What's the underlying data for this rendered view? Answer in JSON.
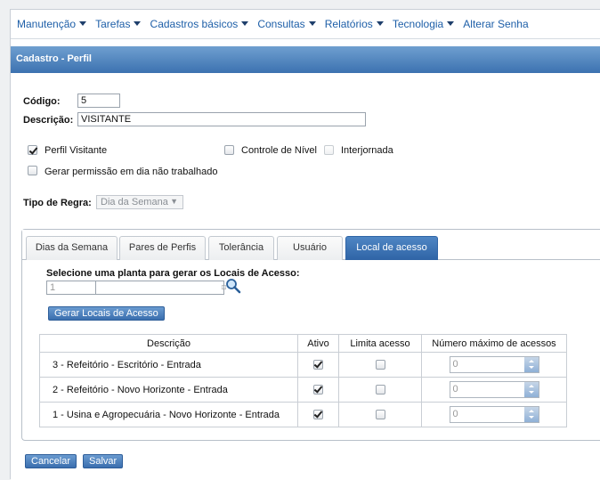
{
  "menu": {
    "items": [
      {
        "label": "Manutenção",
        "has_caret": true
      },
      {
        "label": "Tarefas",
        "has_caret": true
      },
      {
        "label": "Cadastros básicos",
        "has_caret": true
      },
      {
        "label": "Consultas",
        "has_caret": true
      },
      {
        "label": "Relatórios",
        "has_caret": true
      },
      {
        "label": "Tecnologia",
        "has_caret": true
      },
      {
        "label": "Alterar Senha",
        "has_caret": false
      }
    ]
  },
  "panel": {
    "title": "Cadastro - Perfil"
  },
  "form": {
    "codigo_label": "Código:",
    "codigo_value": "5",
    "descricao_label": "Descrição:",
    "descricao_value": "VISITANTE",
    "perfil_visitante_label": "Perfil Visitante",
    "perfil_visitante_checked": true,
    "controle_nivel_label": "Controle de Nível",
    "controle_nivel_checked": false,
    "interjornada_label": "Interjornada",
    "interjornada_checked": false,
    "gerar_permissao_label": "Gerar permissão em dia não trabalhado",
    "gerar_permissao_checked": false,
    "tipo_regra_label": "Tipo de Regra:",
    "tipo_regra_value": "Dia da Semana"
  },
  "tabs": [
    {
      "label": "Dias da Semana",
      "active": false
    },
    {
      "label": "Pares de Perfis",
      "active": false
    },
    {
      "label": "Tolerância",
      "active": false
    },
    {
      "label": "Usuário",
      "active": false
    },
    {
      "label": "Local de acesso",
      "active": true
    }
  ],
  "local_acesso": {
    "select_label": "Selecione uma planta para gerar os Locais de Acesso:",
    "planta_value": "1",
    "gerar_button": "Gerar Locais de Acesso",
    "columns": [
      "Descrição",
      "Ativo",
      "Limita acesso",
      "Número máximo de acessos"
    ],
    "rows": [
      {
        "descricao": "3 - Refeitório - Escritório - Entrada",
        "ativo": true,
        "limita": false,
        "maximo": "0"
      },
      {
        "descricao": "2 - Refeitório - Novo Horizonte - Entrada",
        "ativo": true,
        "limita": false,
        "maximo": "0"
      },
      {
        "descricao": "1 - Usina e Agropecuária - Novo Horizonte - Entrada",
        "ativo": true,
        "limita": false,
        "maximo": "0"
      }
    ]
  },
  "actions": {
    "cancelar": "Cancelar",
    "salvar": "Salvar"
  },
  "colors": {
    "menu_link": "#1e5fa8",
    "header_gradient_top": "#6f9fd0",
    "header_gradient_bottom": "#3c72b0",
    "active_tab": "#2f64a6"
  },
  "icons": {
    "search": "magnifier-icon",
    "dropdown": "chevron-down-icon"
  }
}
